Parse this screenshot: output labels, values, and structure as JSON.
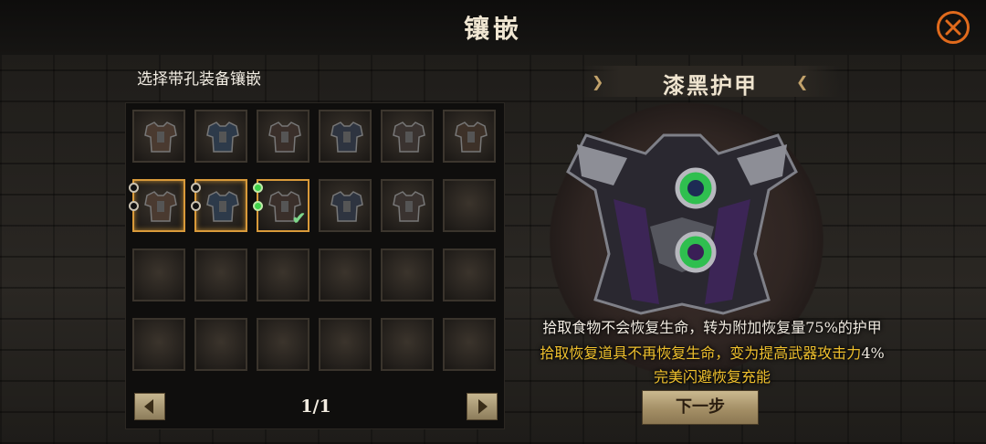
{
  "header": {
    "title": "镶嵌",
    "close_icon": "close-x-icon"
  },
  "inventory": {
    "subtitle": "选择带孔装备镶嵌",
    "rows": [
      [
        "armor",
        "armor",
        "armor",
        "armor",
        "armor",
        "armor"
      ],
      [
        "armor-socketed",
        "armor-socketed",
        "armor-selected",
        "armor",
        "armor",
        "empty"
      ],
      [
        "empty",
        "empty",
        "empty",
        "empty",
        "empty",
        "empty"
      ],
      [
        "empty",
        "empty",
        "empty",
        "empty",
        "empty",
        "empty"
      ]
    ],
    "page": "1/1",
    "prev_icon": "triangle-left-icon",
    "next_icon": "triangle-right-icon"
  },
  "detail": {
    "item_name": "漆黑护甲",
    "desc_line1": "拾取食物不会恢复生命，转为附加恢复量75%的护甲",
    "desc_line2_main": "拾取恢复道具不再恢复生命，变为提高武器攻击力",
    "desc_line2_value": "4%",
    "desc_line3": "完美闪避恢复充能",
    "next_button": "下一步"
  },
  "colors": {
    "accent": "#e06a1c",
    "highlight": "#f0c12e",
    "selected_border": "#d99a3a"
  }
}
